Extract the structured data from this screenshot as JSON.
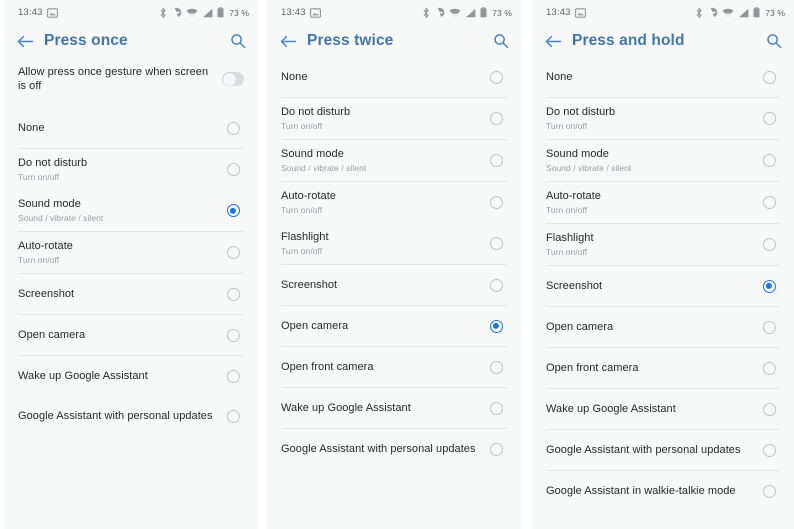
{
  "statusbar": {
    "clock": "13:43",
    "battery_percent": "73 %",
    "icons": [
      "screenshot-icon",
      "bluetooth-icon",
      "do-not-disturb-icon",
      "wifi-icon",
      "cellular-signal-icon",
      "battery-icon"
    ]
  },
  "colors": {
    "accent": "#1a73e8",
    "title": "#4377a8",
    "background": "#f7f8f8",
    "divider": "#e4e6e7",
    "primary_text": "#26282b",
    "secondary_text": "#9aa0a6"
  },
  "screens": [
    {
      "title": "Press once",
      "back_icon": "back-arrow-icon",
      "search_icon": "search-icon",
      "toggle_row": {
        "label": "Allow press once gesture when screen is off",
        "state": "off"
      },
      "items": [
        {
          "label": "None",
          "sub": "",
          "selected": false,
          "divider_after": true
        },
        {
          "label": "Do not disturb",
          "sub": "Turn on/off",
          "selected": false,
          "divider_after": false
        },
        {
          "label": "Sound mode",
          "sub": "Sound / vibrate / silent",
          "selected": true,
          "divider_after": true
        },
        {
          "label": "Auto-rotate",
          "sub": "Turn on/off",
          "selected": false,
          "divider_after": true
        },
        {
          "label": "Screenshot",
          "sub": "",
          "selected": false,
          "divider_after": true
        },
        {
          "label": "Open camera",
          "sub": "",
          "selected": false,
          "divider_after": true
        },
        {
          "label": "Wake up Google Assistant",
          "sub": "",
          "selected": false,
          "divider_after": false
        },
        {
          "label": "Google Assistant with personal updates",
          "sub": "",
          "selected": false,
          "divider_after": false
        }
      ]
    },
    {
      "title": "Press twice",
      "back_icon": "back-arrow-icon",
      "search_icon": "search-icon",
      "toggle_row": null,
      "items": [
        {
          "label": "None",
          "sub": "",
          "selected": false,
          "divider_after": true
        },
        {
          "label": "Do not disturb",
          "sub": "Turn on/off",
          "selected": false,
          "divider_after": true
        },
        {
          "label": "Sound mode",
          "sub": "Sound / vibrate / silent",
          "selected": false,
          "divider_after": true
        },
        {
          "label": "Auto-rotate",
          "sub": "Turn on/off",
          "selected": false,
          "divider_after": false
        },
        {
          "label": "Flashlight",
          "sub": "Turn on/off",
          "selected": false,
          "divider_after": true
        },
        {
          "label": "Screenshot",
          "sub": "",
          "selected": false,
          "divider_after": true
        },
        {
          "label": "Open camera",
          "sub": "",
          "selected": true,
          "divider_after": true
        },
        {
          "label": "Open front camera",
          "sub": "",
          "selected": false,
          "divider_after": true
        },
        {
          "label": "Wake up Google Assistant",
          "sub": "",
          "selected": false,
          "divider_after": true
        },
        {
          "label": "Google Assistant with personal updates",
          "sub": "",
          "selected": false,
          "divider_after": false
        }
      ]
    },
    {
      "title": "Press and hold",
      "back_icon": "back-arrow-icon",
      "search_icon": "search-icon",
      "toggle_row": null,
      "items": [
        {
          "label": "None",
          "sub": "",
          "selected": false,
          "divider_after": true
        },
        {
          "label": "Do not disturb",
          "sub": "Turn on/off",
          "selected": false,
          "divider_after": true
        },
        {
          "label": "Sound mode",
          "sub": "Sound / vibrate / silent",
          "selected": false,
          "divider_after": true
        },
        {
          "label": "Auto-rotate",
          "sub": "Turn on/off",
          "selected": false,
          "divider_after": true
        },
        {
          "label": "Flashlight",
          "sub": "Turn on/off",
          "selected": false,
          "divider_after": true
        },
        {
          "label": "Screenshot",
          "sub": "",
          "selected": true,
          "divider_after": true
        },
        {
          "label": "Open camera",
          "sub": "",
          "selected": false,
          "divider_after": true
        },
        {
          "label": "Open front camera",
          "sub": "",
          "selected": false,
          "divider_after": true
        },
        {
          "label": "Wake up Google Assistant",
          "sub": "",
          "selected": false,
          "divider_after": true
        },
        {
          "label": "Google Assistant with personal updates",
          "sub": "",
          "selected": false,
          "divider_after": true
        },
        {
          "label": "Google Assistant in walkie-talkie mode",
          "sub": "",
          "selected": false,
          "divider_after": false
        }
      ]
    }
  ]
}
